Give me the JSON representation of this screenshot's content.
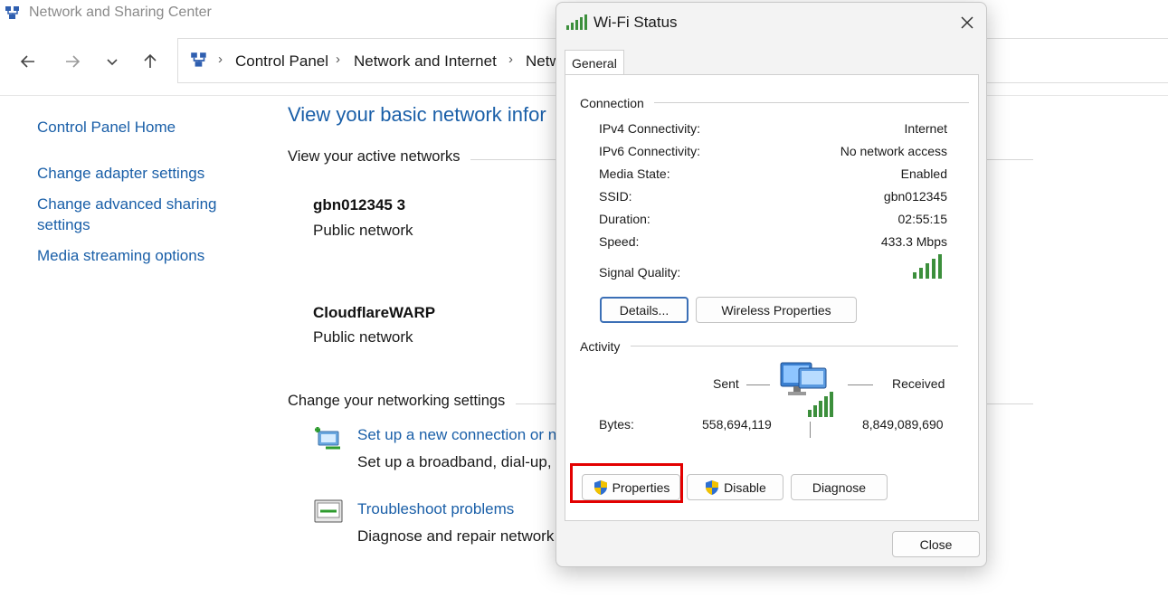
{
  "window": {
    "title": "Network and Sharing Center"
  },
  "nav": {
    "back_icon": "arrow-left-icon",
    "forward_icon": "arrow-right-icon",
    "recent_icon": "chevron-down-icon",
    "up_icon": "arrow-up-icon"
  },
  "breadcrumb": {
    "items": [
      "Control Panel",
      "Network and Internet",
      "Netw"
    ]
  },
  "sidebar": {
    "items": [
      {
        "label": "Control Panel Home"
      },
      {
        "label": "Change adapter settings"
      },
      {
        "label": "Change advanced sharing settings"
      },
      {
        "label": "Media streaming options"
      }
    ]
  },
  "main": {
    "title": "View your basic network infor",
    "active_networks_heading": "View your active networks",
    "networks": [
      {
        "name": "gbn012345 3",
        "type": "Public network"
      },
      {
        "name": "CloudflareWARP",
        "type": "Public network"
      }
    ],
    "settings_heading": "Change your networking settings",
    "tasks": [
      {
        "link": "Set up a new connection or n",
        "desc": "Set up a broadband, dial-up,"
      },
      {
        "link": "Troubleshoot problems",
        "desc": "Diagnose and repair network"
      }
    ]
  },
  "dialog": {
    "title": "Wi-Fi Status",
    "tab": "General",
    "connection_heading": "Connection",
    "rows": [
      {
        "label": "IPv4 Connectivity:",
        "value": "Internet"
      },
      {
        "label": "IPv6 Connectivity:",
        "value": "No network access"
      },
      {
        "label": "Media State:",
        "value": "Enabled"
      },
      {
        "label": "SSID:",
        "value": "gbn012345"
      },
      {
        "label": "Duration:",
        "value": "02:55:15"
      },
      {
        "label": "Speed:",
        "value": "433.3 Mbps"
      }
    ],
    "signal_label": "Signal Quality:",
    "signal_bars": 5,
    "details_button": "Details...",
    "wireless_button": "Wireless Properties",
    "activity_heading": "Activity",
    "sent_label": "Sent",
    "received_label": "Received",
    "bytes_label": "Bytes:",
    "bytes_sent": "558,694,119",
    "bytes_received": "8,849,089,690",
    "properties_button": "Properties",
    "disable_button": "Disable",
    "diagnose_button": "Diagnose",
    "close_button": "Close"
  },
  "colors": {
    "link": "#1a5fa8",
    "highlight": "#e30000",
    "signal": "#3c8f3c"
  }
}
